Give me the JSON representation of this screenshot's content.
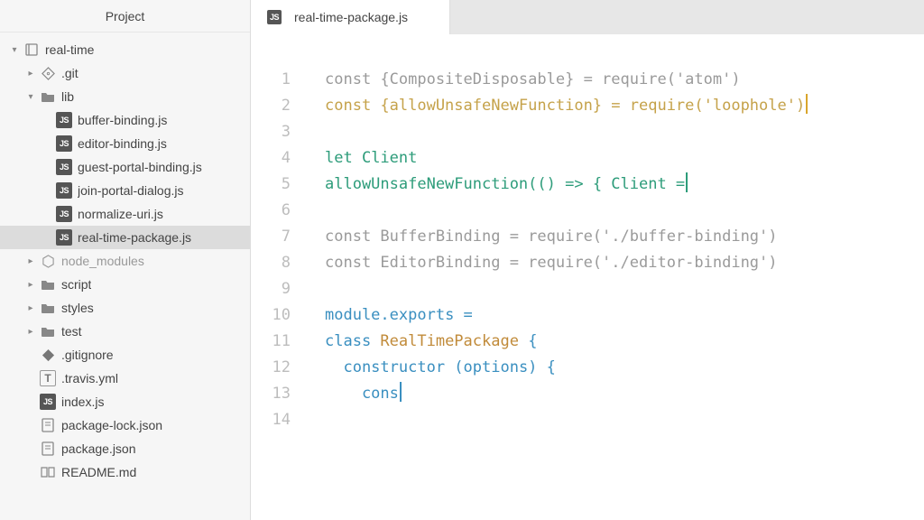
{
  "sidebar": {
    "title": "Project",
    "root": {
      "label": "real-time"
    }
  },
  "tree": {
    "git": {
      "label": ".git"
    },
    "lib": {
      "label": "lib"
    },
    "lib_files": [
      {
        "label": "buffer-binding.js"
      },
      {
        "label": "editor-binding.js"
      },
      {
        "label": "guest-portal-binding.js"
      },
      {
        "label": "join-portal-dialog.js"
      },
      {
        "label": "normalize-uri.js"
      },
      {
        "label": "real-time-package.js"
      }
    ],
    "node_modules": {
      "label": "node_modules"
    },
    "script": {
      "label": "script"
    },
    "styles": {
      "label": "styles"
    },
    "test": {
      "label": "test"
    },
    "gitignore": {
      "label": ".gitignore"
    },
    "travis": {
      "label": ".travis.yml"
    },
    "indexjs": {
      "label": "index.js"
    },
    "pkglock": {
      "label": "package-lock.json"
    },
    "pkg": {
      "label": "package.json"
    },
    "readme": {
      "label": "README.md"
    }
  },
  "tab": {
    "title": "real-time-package.js"
  },
  "code": {
    "l1": "const {CompositeDisposable} = require('atom')",
    "l2": "const {allowUnsafeNewFunction} = require('loophole')",
    "l4a": "let",
    "l4b": " Client",
    "l5a": "allowUnsafeNewFunction",
    "l5b": "(() => { Client =",
    "l7": "const BufferBinding = require('./buffer-binding')",
    "l8": "const EditorBinding = require('./editor-binding')",
    "l10a": "module",
    "l10b": ".exports =",
    "l11a": "class",
    "l11b": " RealTimePackage",
    "l11c": " {",
    "l12a": "  constructor",
    "l12b": " (options) {",
    "l13": "    cons"
  },
  "lines": [
    "1",
    "2",
    "3",
    "4",
    "5",
    "6",
    "7",
    "8",
    "9",
    "10",
    "11",
    "12",
    "13",
    "14"
  ],
  "glyph": {
    "js": "JS",
    "travis": "T"
  }
}
